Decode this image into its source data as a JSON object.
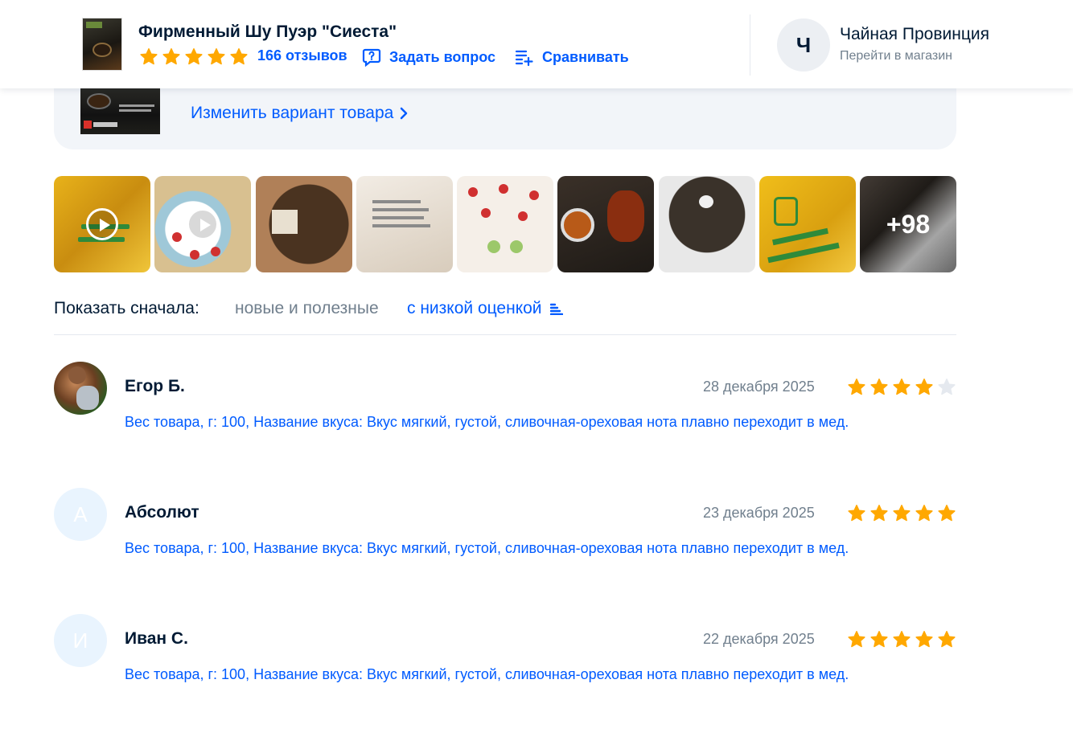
{
  "header": {
    "product_title": "Фирменный Шу Пуэр \"Сиеста\"",
    "rating_stars": 5,
    "reviews_link": "166 отзывов",
    "ask_question": "Задать вопрос",
    "compare": "Сравнивать",
    "shop": {
      "avatar_letter": "Ч",
      "name": "Чайная Провинция",
      "link": "Перейти в магазин"
    }
  },
  "variant": {
    "change_label": "Изменить вариант товара"
  },
  "gallery": {
    "more_count": "+98"
  },
  "sort": {
    "label": "Показать сначала:",
    "option_new": "новые и полезные",
    "option_low": "с низкой оценкой"
  },
  "reviews": [
    {
      "author": "Егор Б.",
      "date": "28 декабря 2025",
      "rating": 4,
      "variant_text": "Вес товара, г: 100, Название вкуса: Вкус мягкий, густой, сливочная-ореховая нота плавно переходит в мед."
    },
    {
      "author": "Абсолют",
      "avatar_letter": "А",
      "date": "23 декабря 2025",
      "rating": 5,
      "variant_text": "Вес товара, г: 100, Название вкуса: Вкус мягкий, густой, сливочная-ореховая нота плавно переходит в мед."
    },
    {
      "author": "Иван С.",
      "avatar_letter": "И",
      "date": "22 декабря 2025",
      "rating": 5,
      "variant_text": "Вес товара, г: 100, Название вкуса: Вкус мягкий, густой, сливочная-ореховая нота плавно переходит в мед."
    }
  ],
  "colors": {
    "accent": "#005bff",
    "star": "#ffa800",
    "star_empty": "#e5e9ef",
    "text_secondary": "#707f8d"
  }
}
